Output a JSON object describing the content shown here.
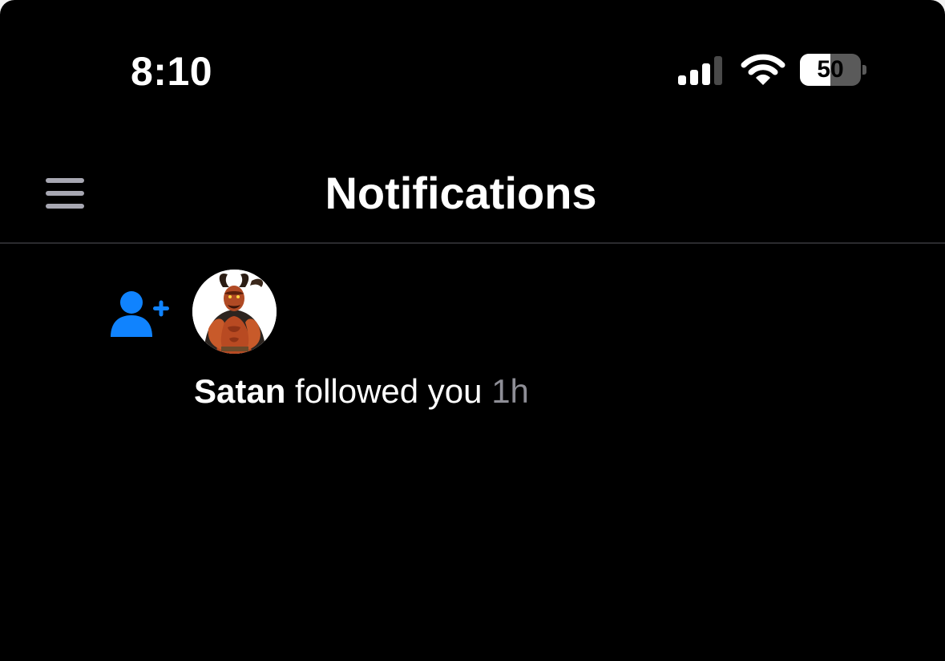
{
  "status_bar": {
    "time": "8:10",
    "battery_level": "50",
    "battery_fraction": 0.5,
    "signal_icon": "cellular-signal-icon",
    "wifi_icon": "wifi-icon"
  },
  "header": {
    "title": "Notifications",
    "menu_icon": "hamburger-menu-icon"
  },
  "notifications": [
    {
      "type_icon": "person-plus-icon",
      "user": "Satan",
      "action": "followed you",
      "time": "1h"
    }
  ],
  "colors": {
    "background": "#000000",
    "accent": "#1083fe",
    "text": "#ffffff",
    "muted_text": "#8e8e96",
    "divider": "#2b2b2e",
    "menu_icon": "#a7a7b2"
  }
}
